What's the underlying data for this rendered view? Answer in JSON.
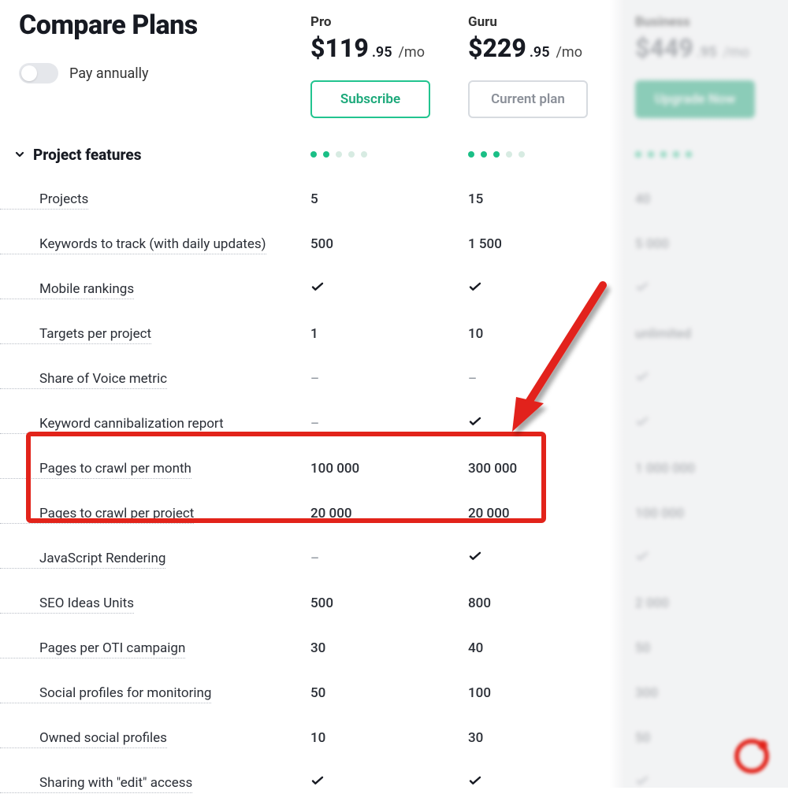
{
  "header": {
    "title": "Compare Plans",
    "toggle_label": "Pay annually"
  },
  "plans": {
    "pro": {
      "name": "Pro",
      "price_main": "$119",
      "price_dec": ".95",
      "price_per": "/mo",
      "cta": "Subscribe"
    },
    "guru": {
      "name": "Guru",
      "price_main": "$229",
      "price_dec": ".95",
      "price_per": "/mo",
      "cta": "Current plan"
    },
    "biz": {
      "name": "Business",
      "price_main": "$449",
      "price_dec": ".95",
      "price_per": "/mo",
      "cta": "Upgrade Now"
    }
  },
  "section": {
    "title": "Project features"
  },
  "dots": {
    "pro": 2,
    "guru": 3,
    "biz": 5,
    "total": 5
  },
  "features": [
    {
      "label": "Projects",
      "pro": "5",
      "guru": "15",
      "biz": "40"
    },
    {
      "label": "Keywords to track (with daily updates)",
      "pro": "500",
      "guru": "1 500",
      "biz": "5 000"
    },
    {
      "label": "Mobile rankings",
      "pro": "check",
      "guru": "check",
      "biz": "check"
    },
    {
      "label": "Targets per project",
      "pro": "1",
      "guru": "10",
      "biz": "unlimited"
    },
    {
      "label": "Share of Voice metric",
      "pro": "dash",
      "guru": "dash",
      "biz": "check"
    },
    {
      "label": "Keyword cannibalization report",
      "pro": "dash",
      "guru": "check",
      "biz": "check"
    },
    {
      "label": "Pages to crawl per month",
      "pro": "100 000",
      "guru": "300 000",
      "biz": "1 000 000"
    },
    {
      "label": "Pages to crawl per project",
      "pro": "20 000",
      "guru": "20 000",
      "biz": "100 000"
    },
    {
      "label": "JavaScript Rendering",
      "pro": "dash",
      "guru": "check",
      "biz": "check"
    },
    {
      "label": "SEO Ideas Units",
      "pro": "500",
      "guru": "800",
      "biz": "2 000"
    },
    {
      "label": "Pages per OTI campaign",
      "pro": "30",
      "guru": "40",
      "biz": "50"
    },
    {
      "label": "Social profiles for monitoring",
      "pro": "50",
      "guru": "100",
      "biz": "300"
    },
    {
      "label": "Owned social profiles",
      "pro": "10",
      "guru": "30",
      "biz": "50"
    },
    {
      "label": "Sharing with \"edit\" access",
      "pro": "check",
      "guru": "check",
      "biz": "check"
    }
  ]
}
